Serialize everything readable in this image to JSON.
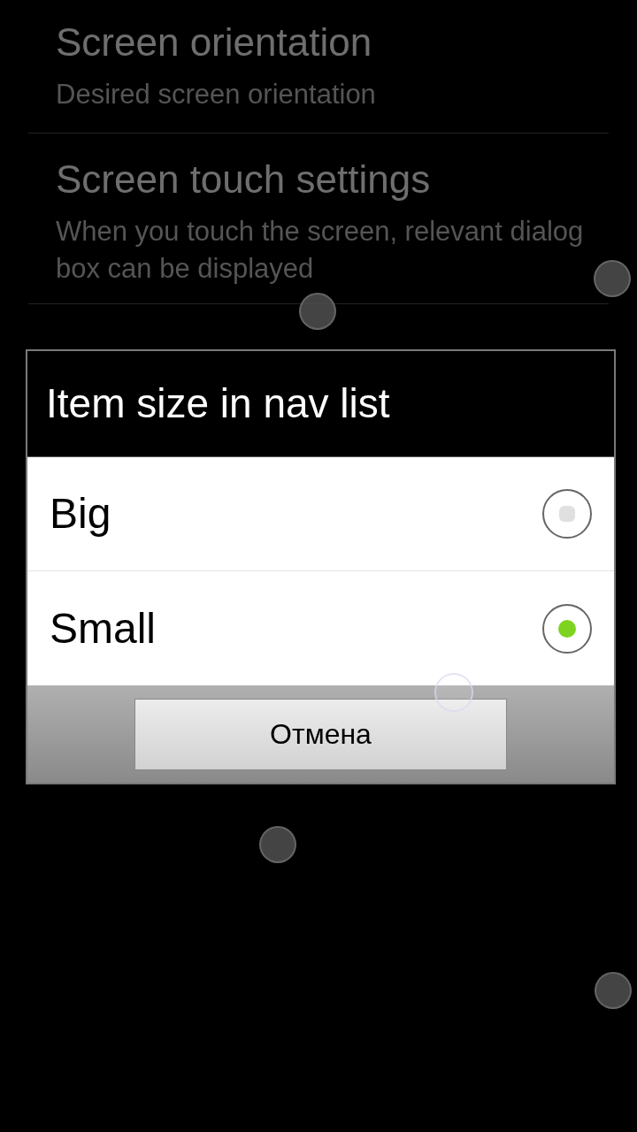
{
  "settings": [
    {
      "title": "Screen orientation",
      "subtitle": "Desired screen orientation"
    },
    {
      "title": "Screen touch settings",
      "subtitle": "When you touch the screen, relevant dialog box can be displayed"
    }
  ],
  "dialog": {
    "title": "Item size in nav list",
    "options": [
      {
        "label": "Big",
        "selected": false
      },
      {
        "label": "Small",
        "selected": true
      }
    ],
    "buttons": [
      "Отмена"
    ]
  }
}
